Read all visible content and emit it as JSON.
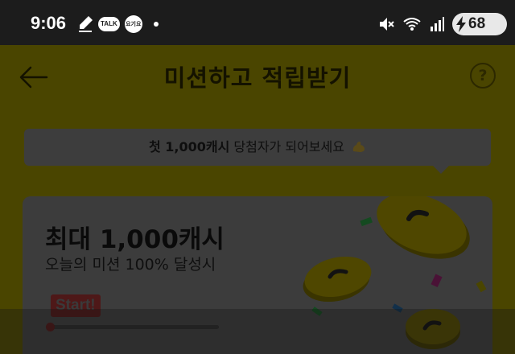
{
  "status_bar": {
    "time": "9:06",
    "talk_label": "TALK",
    "app_label": "요기요",
    "battery": "68",
    "icons": [
      "pen-icon",
      "talk-icon",
      "app-icon",
      "dot-icon",
      "mute-icon",
      "wifi-icon",
      "signal-icon",
      "charging-icon"
    ]
  },
  "header": {
    "title": "미션하고 적립받기",
    "help": "?"
  },
  "promo": {
    "prefix": "첫 1,000캐시",
    "suffix": " 당첨자가 되어보세요"
  },
  "mission_card": {
    "title": "최대 1,000캐시",
    "subtitle": "오늘의 미션 100% 달성시",
    "start_label": "Start!",
    "progress": 0.0
  },
  "colors": {
    "background": "#1a1a1a",
    "page_dimmed_yellow": "#4a4500",
    "card": "#3c3c3c",
    "start_red": "#4e1818"
  }
}
